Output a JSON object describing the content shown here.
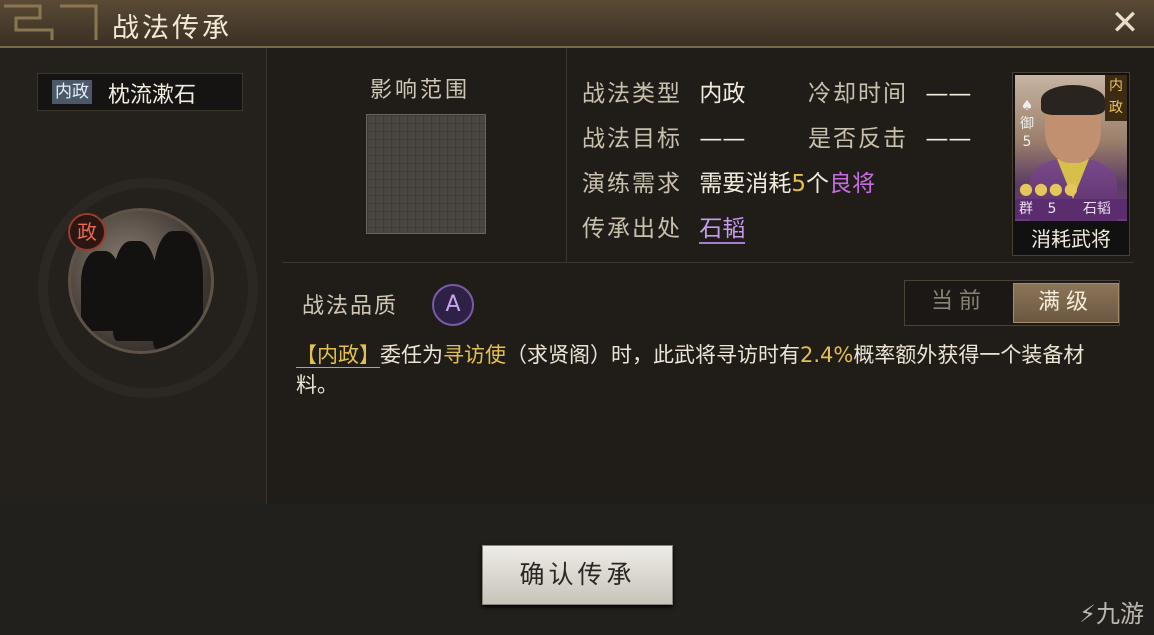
{
  "window": {
    "title": "战法传承",
    "close_icon": "close-icon"
  },
  "skill": {
    "tag": "内政",
    "name": "枕流漱石",
    "badge": "政"
  },
  "range": {
    "label": "影响范围"
  },
  "info": {
    "type_label": "战法类型",
    "type_value": "内政",
    "cooldown_label": "冷却时间",
    "cooldown_value": "——",
    "target_label": "战法目标",
    "target_value": "——",
    "counter_label": "是否反击",
    "counter_value": "——",
    "drill_label": "演练需求",
    "drill_prefix": "需要消耗",
    "drill_count": "5",
    "drill_unit": "个",
    "drill_quality": "良将",
    "origin_label": "传承出处",
    "origin_value": "石韬"
  },
  "card": {
    "tag": "内政",
    "side_char": "御",
    "side_num": "5",
    "stars": "●●●●",
    "faction": "群",
    "cost": "5",
    "name": "石韬",
    "caption": "消耗武将"
  },
  "quality": {
    "label": "战法品质",
    "grade": "A"
  },
  "toggle": {
    "current": "当前",
    "max": "满级"
  },
  "description": {
    "tag": "【内政】",
    "p1": "委任为",
    "role": "寻访使",
    "p2": "（求贤阁）时，此武将寻访时有",
    "rate": "2.4%",
    "p3": "概率额外获得一个装备材料。"
  },
  "confirm": {
    "label": "确认传承"
  },
  "watermark": "九游"
}
